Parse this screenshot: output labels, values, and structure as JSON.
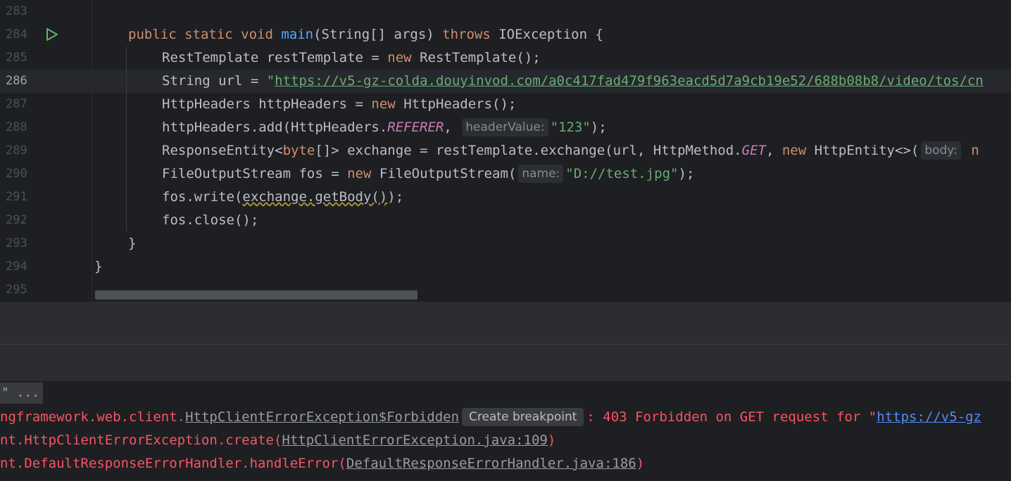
{
  "editor": {
    "line_numbers": [
      "283",
      "284",
      "285",
      "286",
      "287",
      "288",
      "289",
      "290",
      "291",
      "292",
      "293",
      "294",
      "295"
    ],
    "current_line": "286",
    "l284": {
      "kw1": "public static void ",
      "fn": "main",
      "rest": "(String[] args) ",
      "kw2": "throws",
      "rest2": " IOException {"
    },
    "l285": {
      "a": "RestTemplate restTemplate = ",
      "kw": "new",
      "b": " RestTemplate();"
    },
    "l286": {
      "a": "String url = ",
      "q": "\"",
      "url": "https://v5-gz-colda.douyinvod.com/a0c417fad479f963eacd5d7a9cb19e52/688b08b8/video/tos/cn"
    },
    "l287": {
      "a": "HttpHeaders httpHeaders = ",
      "kw": "new",
      "b": " HttpHeaders();"
    },
    "l288": {
      "a": "httpHeaders.add(HttpHeaders.",
      "field": "REFERER",
      "b": ", ",
      "hint": "headerValue:",
      "str": "\"123\"",
      "c": ");"
    },
    "l289": {
      "a": "ResponseEntity<",
      "kw1": "byte",
      "b": "[]> exchange = restTemplate.exchange(url, HttpMethod.",
      "field": "GET",
      "c": ", ",
      "kw2": "new",
      "d": " HttpEntity<>(",
      "hint": "body:",
      "e": " n"
    },
    "l290": {
      "a": "FileOutputStream fos = ",
      "kw": "new",
      "b": " FileOutputStream(",
      "hint": "name:",
      "str": "\"D://test.jpg\"",
      "c": ");"
    },
    "l291": {
      "a": "fos.write(",
      "squig": "exchange.getBody()",
      "b": ");"
    },
    "l292": {
      "a": "fos.close();"
    },
    "l293": {
      "a": "}"
    },
    "l294": {
      "a": "}"
    }
  },
  "console": {
    "collapsed_label": "\" ...",
    "line1": {
      "a": "ngframework.web.client.",
      "link": "HttpClientErrorException$Forbidden",
      "chip": "Create breakpoint",
      "b": ": 403 Forbidden on GET request for ",
      "q": "\"",
      "url": "https://v5-gz"
    },
    "line2": {
      "a": "nt.HttpClientErrorException.create(",
      "link": "HttpClientErrorException.java:109",
      "b": ")"
    },
    "line3": {
      "a": "nt.DefaultResponseErrorHandler.handleError(",
      "link": "DefaultResponseErrorHandler.java:186",
      "b": ")"
    }
  },
  "colors": {
    "background": "#1e1f22",
    "keyword": "#cf8e6d",
    "string": "#6aab73",
    "function": "#56a8f5",
    "field": "#c77dbb",
    "error": "#f75464",
    "link": "#548af7"
  },
  "icons": {
    "run": "run-gutter-icon"
  }
}
